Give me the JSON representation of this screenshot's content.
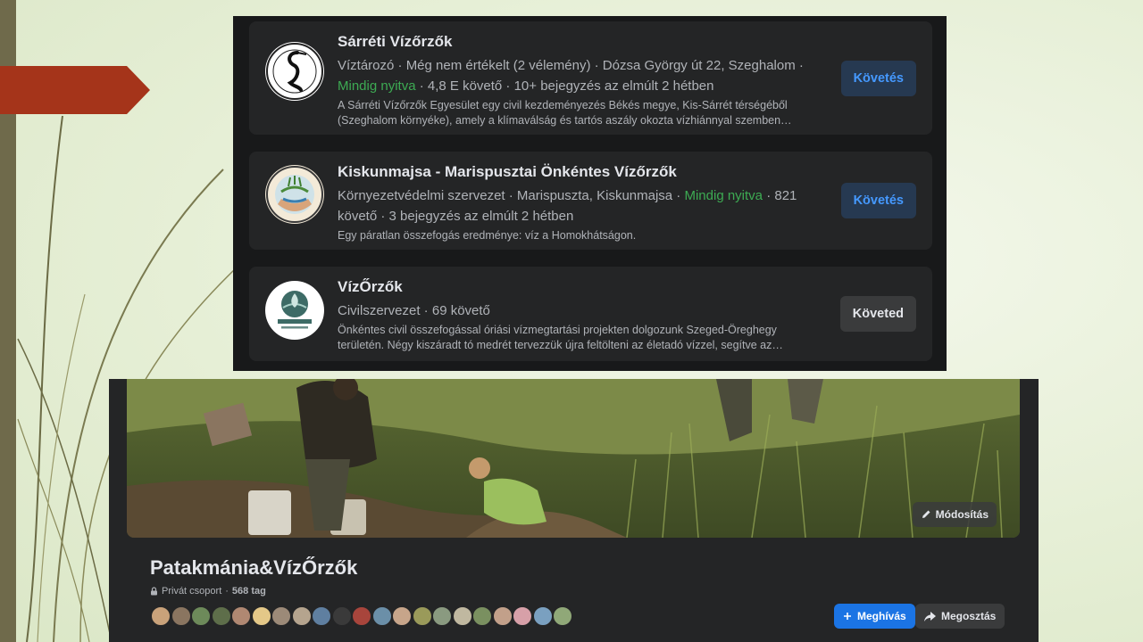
{
  "results": [
    {
      "name": "Sárréti Vízőrzők",
      "meta_before": "Víztározó · Még nem értékelt (2 vélemény) · Dózsa György út 22, Szeghalom ·",
      "open_status": "Mindig nyitva",
      "meta_after": " · 4,8 E követő · 10+ bejegyzés az elmúlt 2 hétben",
      "desc_line1": "A Sárréti Vízőrzők Egyesület egy civil kezdeményezés Békés megye, Kis-Sárrét térségéből",
      "desc_line2": "(Szeghalom környéke), amely a klímaválság és tartós aszály okozta vízhiánnyal szemben…",
      "button": "Követés",
      "avatar_icon": "heron-logo-icon"
    },
    {
      "name": "Kiskunmajsa - Marispusztai Önkéntes Vízőrzők",
      "meta_before": "Környezetvédelmi szervezet · Marispuszta, Kiskunmajsa · ",
      "open_status": "Mindig nyitva",
      "meta_after": " · 821",
      "meta_line2": "követő · 3 bejegyzés az elmúlt 2 hétben",
      "desc_line1": "Egy páratlan összefogás eredménye: víz a Homokhátságon.",
      "button": "Követés",
      "avatar_icon": "hands-water-logo-icon"
    },
    {
      "name": "VízŐrzők",
      "meta_before": "Civilszervezet · 69 követő",
      "desc_line1": "Önkéntes civil összefogással óriási vízmegtartási projekten dolgozunk Szeged-Öreghegy",
      "desc_line2": "területén. Négy kiszáradt tó medrét tervezzük újra feltölteni az életadó vízzel, segítve az…",
      "button": "Követed",
      "avatar_icon": "vizorzok-logo-icon"
    }
  ],
  "group": {
    "title": "Patakmánia&VízŐrzők",
    "privacy": "Privát csoport",
    "members": "568 tag",
    "edit_label": "Módosítás",
    "invite_label": "Meghívás",
    "share_label": "Megosztás",
    "member_colors": [
      "#c9a27a",
      "#8a7560",
      "#6d8a5a",
      "#5e6e4a",
      "#b08872",
      "#e4c888",
      "#9c8a78",
      "#b5a48e",
      "#5f7fa0",
      "#3a3a3a",
      "#a8453c",
      "#6b8fa8",
      "#c7a58a",
      "#9a9a5a",
      "#8a9a80",
      "#c0b8a0",
      "#7a9060",
      "#c2a08a",
      "#d7a0a8",
      "#7aa0c0",
      "#90a878"
    ]
  },
  "colors": {
    "accent_red": "#a5341a",
    "open_green": "#3dab53",
    "follow_blue": "#4599ff",
    "invite_blue": "#1b74e4"
  }
}
